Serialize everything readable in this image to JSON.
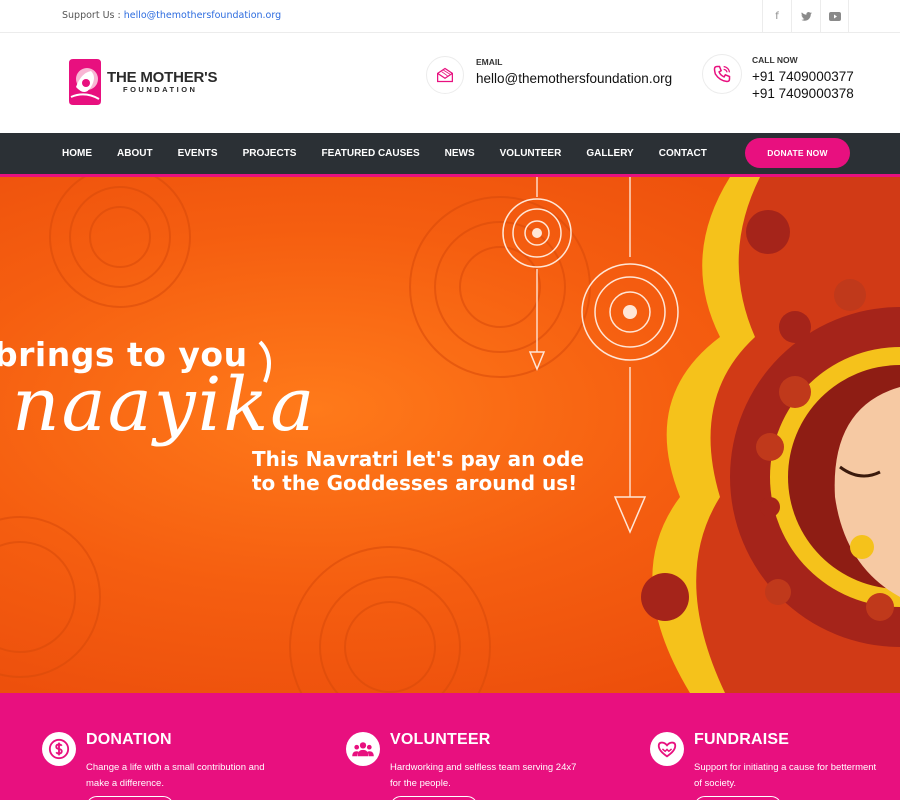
{
  "topbar": {
    "support_label": "Support Us : ",
    "support_email": "hello@themothersfoundation.org",
    "social": [
      {
        "icon": "facebook-icon",
        "glyph": "f"
      },
      {
        "icon": "twitter-icon",
        "glyph": "t"
      },
      {
        "icon": "youtube-icon",
        "glyph": "▶"
      }
    ]
  },
  "header": {
    "logo": {
      "line1": "THE MOTHER'S",
      "line2": "FOUNDATION"
    },
    "email": {
      "label": "EMAIL",
      "value": "hello@themothersfoundation.org",
      "icon": "envelope-icon"
    },
    "phone": {
      "label": "CALL NOW",
      "values": [
        "+91 7409000377",
        "+91 7409000378"
      ],
      "icon": "phone-icon"
    }
  },
  "nav": {
    "items": [
      "HOME",
      "ABOUT",
      "EVENTS",
      "PROJECTS",
      "FEATURED CAUSES",
      "NEWS",
      "VOLUNTEER",
      "GALLERY",
      "CONTACT"
    ],
    "donate_label": "DONATE NOW"
  },
  "hero": {
    "line1": "brings to you",
    "title": "naayika",
    "line2": "This Navratri let's pay an ode",
    "line3": "to the Goddesses around us!"
  },
  "features": [
    {
      "title": "DONATION",
      "desc": "Change a life with a small contribution and make a difference.",
      "icon": "dollar-icon"
    },
    {
      "title": "VOLUNTEER",
      "desc": "Hardworking and selfless team serving 24x7 for the people.",
      "icon": "people-icon"
    },
    {
      "title": "FUNDRAISE",
      "desc": "Support for initiating a cause for betterment of society.",
      "icon": "heart-hands-icon"
    }
  ],
  "colors": {
    "accent": "#e8107f",
    "nav_bg": "#2b3035",
    "hero_orange": "#f55e10",
    "link_blue": "#2d6cdf"
  }
}
